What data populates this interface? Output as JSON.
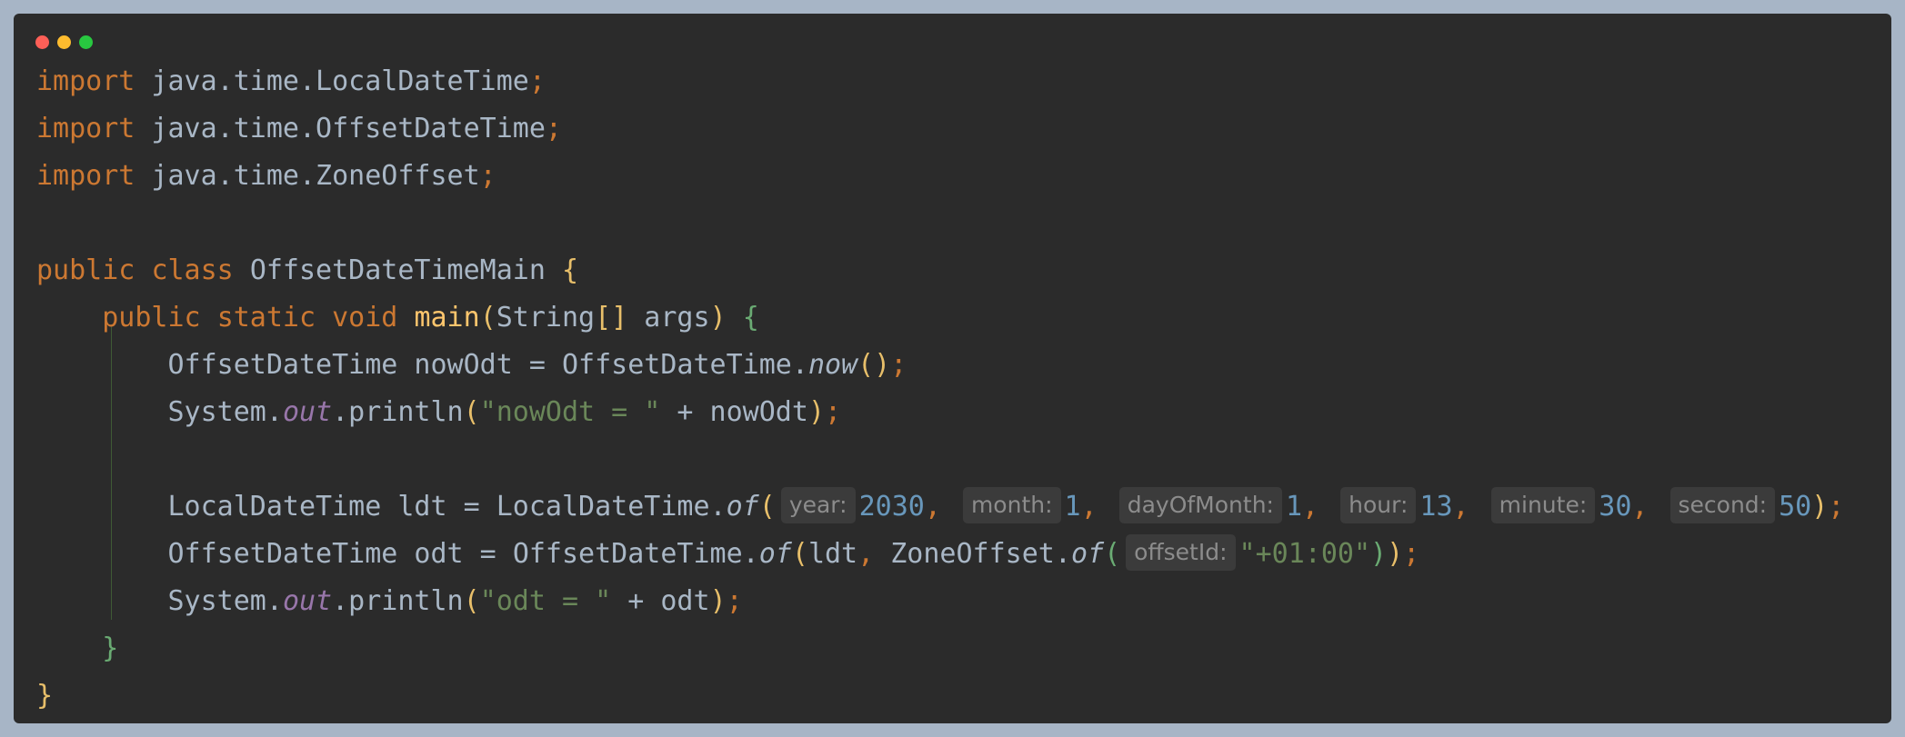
{
  "code": {
    "l1": {
      "kw": "import",
      "pkg": " java.time.LocalDateTime",
      "semi": ";"
    },
    "l2": {
      "kw": "import",
      "pkg": " java.time.OffsetDateTime",
      "semi": ";"
    },
    "l3": {
      "kw": "import",
      "pkg": " java.time.ZoneOffset",
      "semi": ";"
    },
    "l5": {
      "kw1": "public",
      "kw2": "class",
      "name": "OffsetDateTimeMain",
      "brace": "{"
    },
    "l6": {
      "kw1": "public",
      "kw2": "static",
      "kw3": "void",
      "method": "main",
      "open": "(",
      "param_type": "String",
      "arr": "[]",
      "param": " args",
      "close": ")",
      "brace": "{"
    },
    "l7": {
      "type": "OffsetDateTime",
      "var": " nowOdt = ",
      "cls": "OffsetDateTime.",
      "call": "now",
      "parens": "()",
      "semi": ";"
    },
    "l8": {
      "sys": "System.",
      "field": "out",
      "call": ".println",
      "open": "(",
      "str": "\"nowOdt = \"",
      "rest": " + nowOdt",
      "close": ")",
      "semi": ";"
    },
    "l10": {
      "type": "LocalDateTime",
      "var": " ldt = ",
      "cls": "LocalDateTime.",
      "call": "of",
      "open": "(",
      "hint_year": "year:",
      "year": "2030",
      "hint_month": "month:",
      "month": "1",
      "hint_day": "dayOfMonth:",
      "day": "1",
      "hint_hour": "hour:",
      "hour": "13",
      "hint_minute": "minute:",
      "minute": "30",
      "hint_second": "second:",
      "second": "50",
      "comma": ",",
      "close": ")",
      "semi": ";"
    },
    "l11": {
      "type": "OffsetDateTime",
      "var": " odt = ",
      "cls": "OffsetDateTime.",
      "call": "of",
      "open": "(",
      "arg1": "ldt",
      "comma": ",",
      "cls2": " ZoneOffset.",
      "call2": "of",
      "open2": "(",
      "hint_offset": "offsetId:",
      "str": "\"+01:00\"",
      "close2": ")",
      "close": ")",
      "semi": ";"
    },
    "l12": {
      "sys": "System.",
      "field": "out",
      "call": ".println",
      "open": "(",
      "str": "\"odt = \"",
      "rest": " + odt",
      "close": ")",
      "semi": ";"
    },
    "l13": {
      "brace": "}"
    },
    "l14": {
      "brace": "}"
    }
  },
  "colors": {
    "background": "#2b2b2b",
    "keyword": "#cc7832",
    "string": "#6a8759",
    "number": "#6897bb",
    "method": "#ffc66d",
    "field": "#9876aa",
    "text": "#a9b7c6"
  }
}
